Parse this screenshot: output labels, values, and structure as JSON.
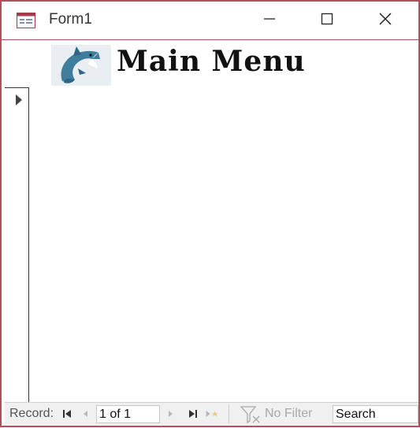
{
  "window": {
    "title": "Form1",
    "icon": "form-icon",
    "controls": [
      "minimize-icon",
      "maximize-icon",
      "close-icon"
    ]
  },
  "header": {
    "logo": "shark-logo",
    "heading": "Main Menu"
  },
  "record_selector": {
    "icon": "current-record-arrow-icon"
  },
  "navigation": {
    "label": "Record:",
    "position": "1 of 1",
    "buttons": [
      "first-record-icon",
      "previous-record-icon",
      "next-record-icon",
      "last-record-icon",
      "new-record-icon"
    ],
    "filter_label": "No Filter",
    "search_placeholder": "Search"
  },
  "colors": {
    "border": "#b2505a",
    "navbar_bg": "#f0f0f0"
  }
}
